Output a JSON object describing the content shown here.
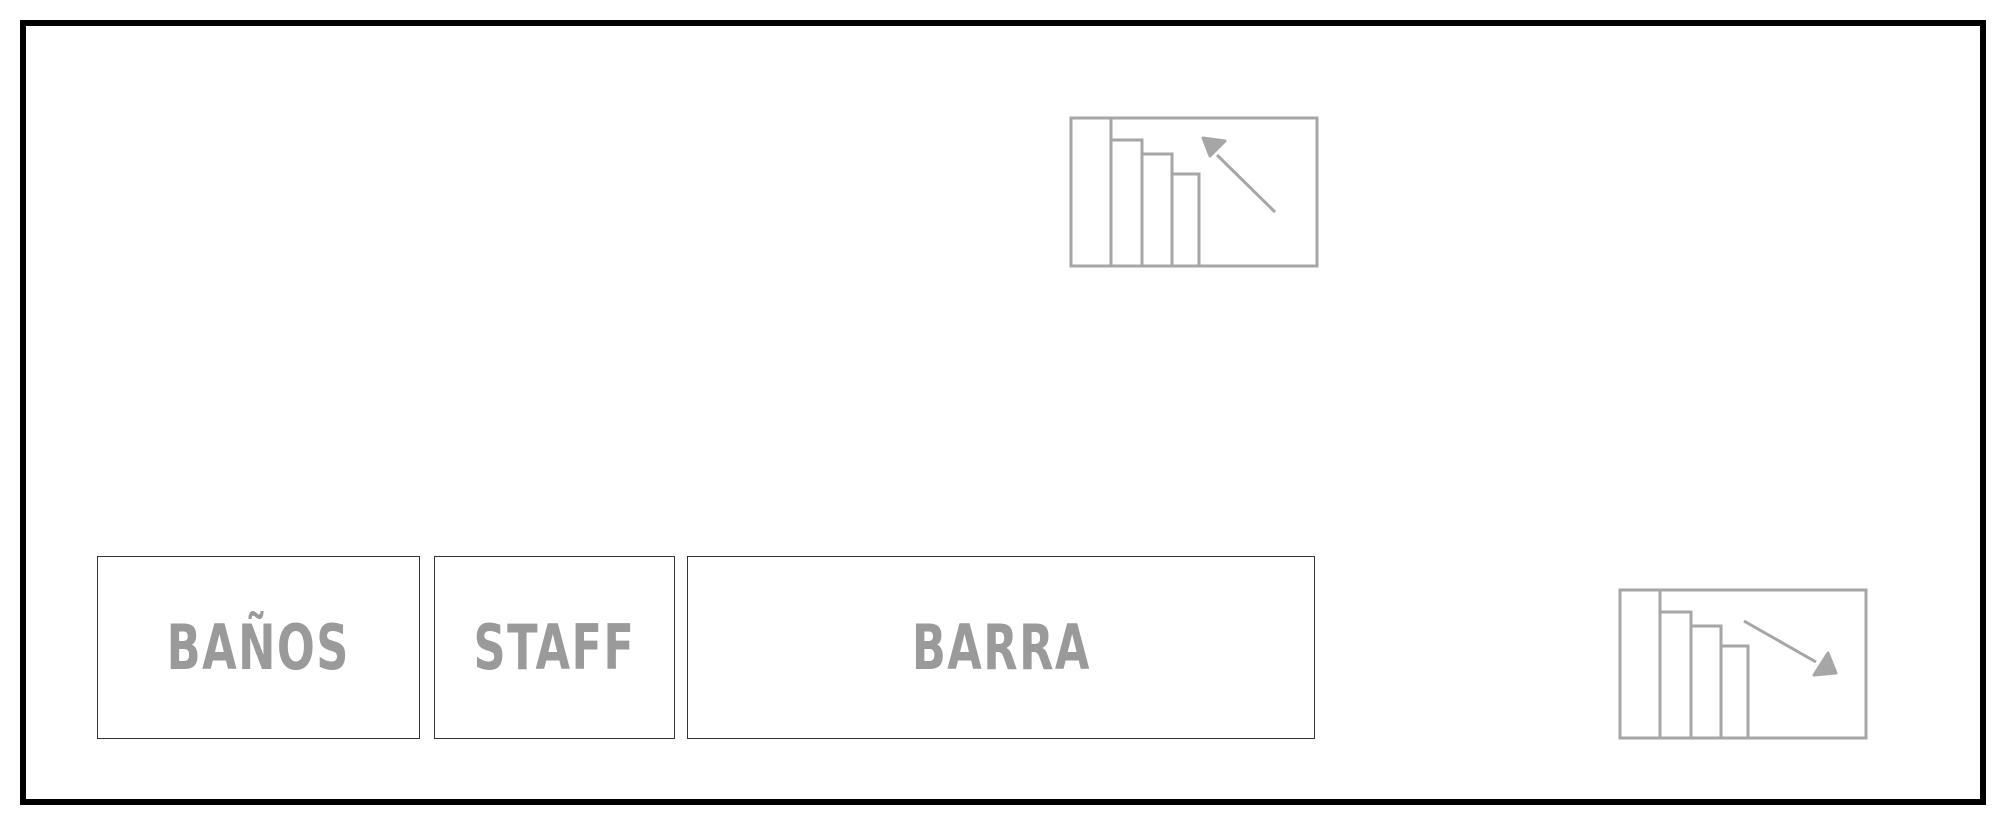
{
  "zones": {
    "banos": {
      "label": "BAÑOS"
    },
    "staff": {
      "label": "STAFF"
    },
    "barra": {
      "label": "BARRA"
    }
  },
  "icons": {
    "stairs_up": "stairs-up-icon",
    "stairs_down": "stairs-down-icon"
  },
  "colors": {
    "outline": "#000000",
    "zone_border": "#333333",
    "label_text": "#9a9a9a",
    "icon_stroke": "#a6a6a6"
  }
}
